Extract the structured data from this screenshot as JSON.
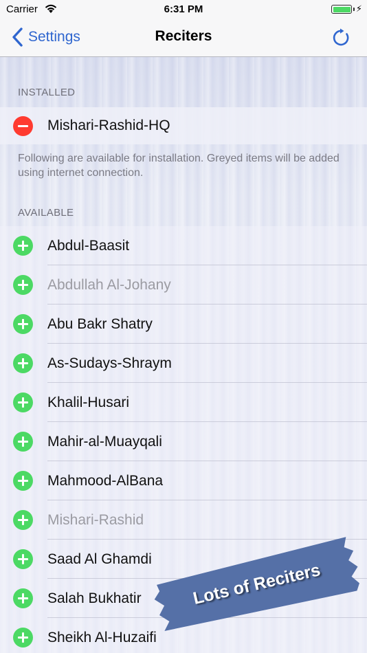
{
  "status_bar": {
    "carrier": "Carrier",
    "time": "6:31 PM",
    "icons": [
      "wifi-icon",
      "battery-icon",
      "charging-bolt-icon"
    ],
    "battery_color": "#4cd964"
  },
  "nav": {
    "back_label": "Settings",
    "title": "Reciters",
    "tint": "#2f66cf",
    "back_icon": "chevron-left-icon",
    "right_icon": "refresh-icon"
  },
  "installed": {
    "header": "INSTALLED",
    "items": [
      {
        "label": "Mishari-Rashid-HQ",
        "icon": "remove-icon"
      }
    ],
    "footer": "Following are available for installation. Greyed items will be added using internet connection."
  },
  "available": {
    "header": "AVAILABLE",
    "items": [
      {
        "label": "Abdul-Baasit",
        "greyed": false,
        "icon": "add-icon"
      },
      {
        "label": "Abdullah Al-Johany",
        "greyed": true,
        "icon": "add-icon"
      },
      {
        "label": "Abu Bakr Shatry",
        "greyed": false,
        "icon": "add-icon"
      },
      {
        "label": "As-Sudays-Shraym",
        "greyed": false,
        "icon": "add-icon"
      },
      {
        "label": "Khalil-Husari",
        "greyed": false,
        "icon": "add-icon"
      },
      {
        "label": "Mahir-al-Muayqali",
        "greyed": false,
        "icon": "add-icon"
      },
      {
        "label": "Mahmood-AlBana",
        "greyed": false,
        "icon": "add-icon"
      },
      {
        "label": "Mishari-Rashid",
        "greyed": true,
        "icon": "add-icon"
      },
      {
        "label": "Saad Al Ghamdi",
        "greyed": false,
        "icon": "add-icon"
      },
      {
        "label": "Salah Bukhatir",
        "greyed": false,
        "icon": "add-icon"
      },
      {
        "label": "Sheikh Al-Huzaifi",
        "greyed": false,
        "icon": "add-icon"
      }
    ]
  },
  "promo_banner": {
    "text": "Lots of Reciters",
    "color": "#5570a7"
  },
  "colors": {
    "add": "#4cd964",
    "remove": "#ff3b30",
    "greyed_text": "#9b9ba2"
  }
}
